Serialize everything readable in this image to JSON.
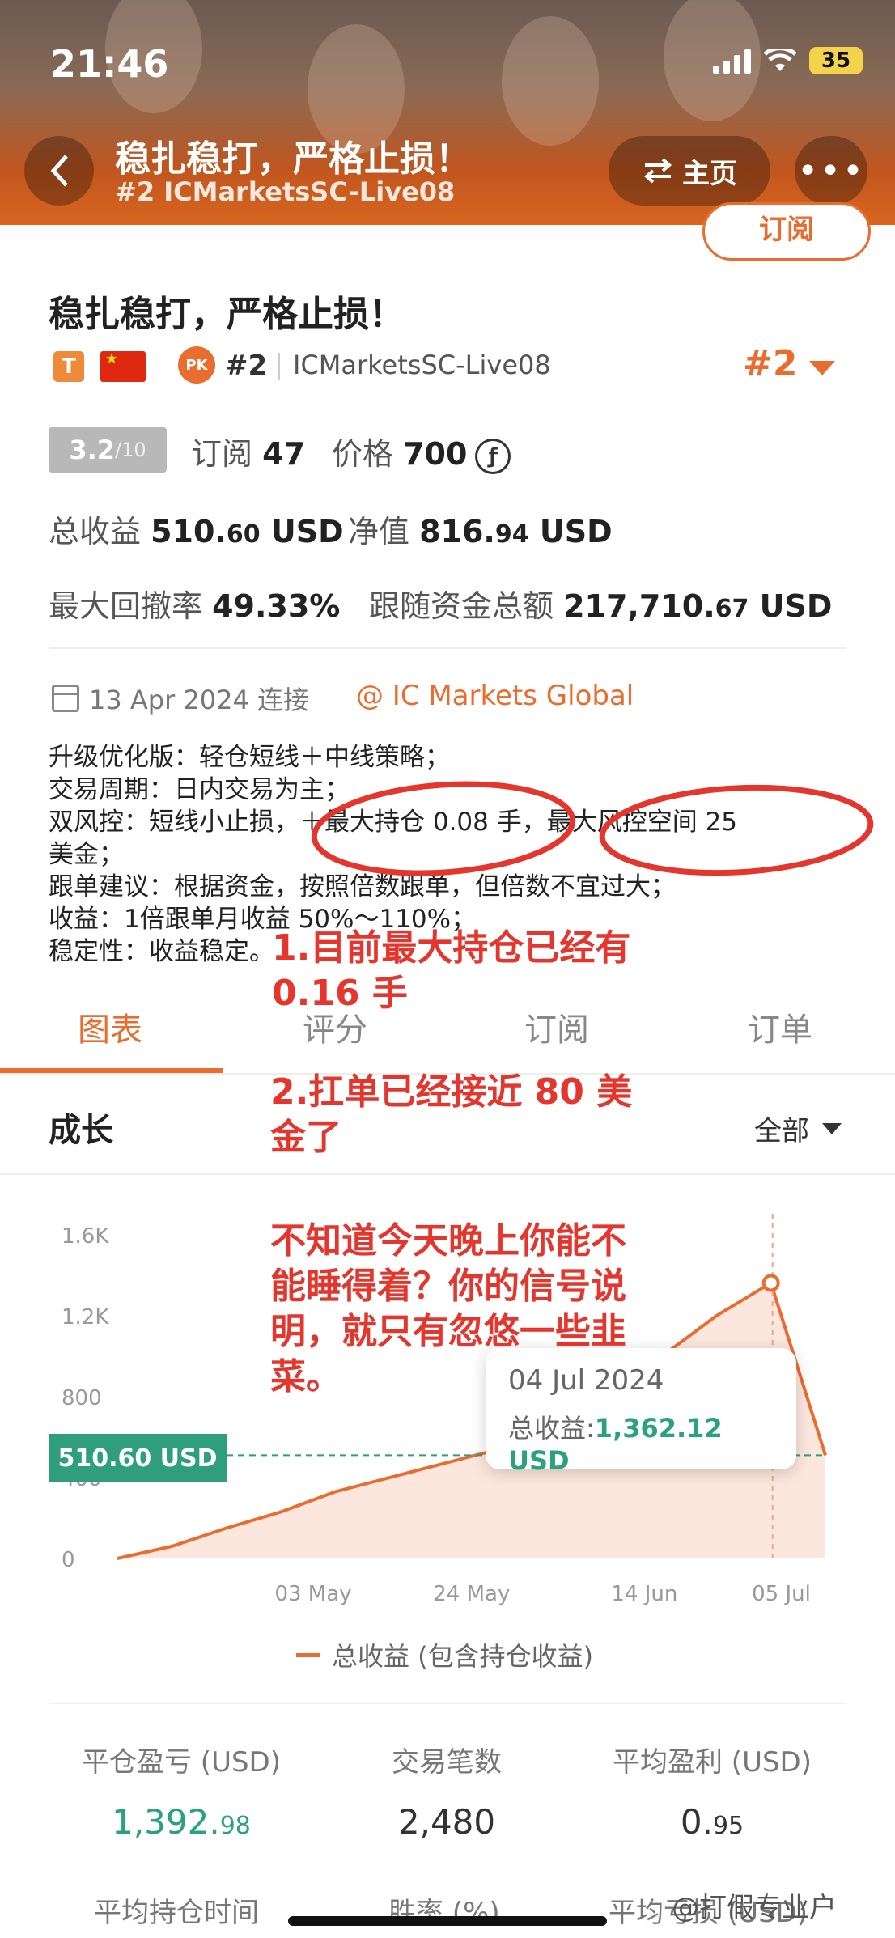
{
  "status_bar": {
    "time": "21:46",
    "battery": "35"
  },
  "header": {
    "title": "稳扎稳打，严格止损！",
    "subtitle": "#2 ICMarketsSC-Live08",
    "home_label": "主页",
    "more_label": "•••",
    "subscribe_label": "订阅"
  },
  "profile": {
    "title": "稳扎稳打，严格止损！",
    "tag": "T",
    "pk_badge": "PK",
    "rank": "#2",
    "server": "ICMarketsSC-Live08",
    "rank_right": "#2"
  },
  "stats": {
    "rating": "3.2",
    "rating_den": "/10",
    "subscribers_label": "订阅",
    "subscribers": "47",
    "price_label": "价格",
    "price": "700",
    "coin_icon": "ƒ",
    "total_profit_label": "总收益",
    "total_profit_int": "510.",
    "total_profit_dec": "60",
    "currency": "USD",
    "equity_label": "净值",
    "equity_int": "816.",
    "equity_dec": "94",
    "max_drawdown_label": "最大回撤率",
    "max_drawdown": "49.33%",
    "follow_funds_label": "跟随资金总额",
    "follow_funds_int": "217,710.",
    "follow_funds_dec": "67"
  },
  "connection": {
    "date": "13 Apr 2024 连接",
    "broker": "@ IC Markets Global"
  },
  "description": [
    "升级优化版：轻仓短线＋中线策略；",
    "交易周期：日内交易为主；",
    "双风控：短线小止损，＋最大持仓 0.08 手，最大风控空间 25",
    "美金；",
    "跟单建议：根据资金，按照倍数跟单，但倍数不宜过大；",
    "收益：1倍跟单月收益 50%～110%；",
    "稳定性：收益稳定。"
  ],
  "annotations": {
    "a1": "1.目前最大持仓已经有\n0.16 手",
    "a2": "2.扛单已经接近 80 美\n金了",
    "a3": "不知道今天晚上你能不\n能睡得着？你的信号说\n明，就只有忽悠一些韭\n菜。"
  },
  "tabs": [
    "图表",
    "评分",
    "订阅",
    "订单"
  ],
  "growth": {
    "title": "成长",
    "range": "全部"
  },
  "chart_data": {
    "type": "area",
    "x_ticks": [
      "03 May",
      "24 May",
      "14 Jun",
      "05 Jul"
    ],
    "y_ticks": [
      "1.6K",
      "1.2K",
      "800",
      "400",
      "0"
    ],
    "ylim": [
      0,
      1600
    ],
    "series": [
      {
        "name": "总收益 (包含持仓收益)",
        "points": [
          [
            "13 Apr",
            0
          ],
          [
            "20 Apr",
            60
          ],
          [
            "27 Apr",
            150
          ],
          [
            "03 May",
            230
          ],
          [
            "10 May",
            330
          ],
          [
            "17 May",
            400
          ],
          [
            "24 May",
            470
          ],
          [
            "31 May",
            540
          ],
          [
            "07 Jun",
            620
          ],
          [
            "14 Jun",
            800
          ],
          [
            "21 Jun",
            1000
          ],
          [
            "28 Jun",
            1200
          ],
          [
            "04 Jul",
            1362.12
          ],
          [
            "05 Jul",
            510.6
          ]
        ]
      }
    ],
    "current_value": "510.60 USD",
    "tooltip": {
      "date": "04 Jul 2024",
      "label": "总收益:",
      "value": "1,362.12 USD"
    },
    "colors": {
      "line": "#ea6d2f",
      "fill": "#fbe1d6",
      "reference": "#2f9e7a"
    }
  },
  "metrics": [
    {
      "label": "平仓盈亏 (USD)",
      "int": "1,392.",
      "dec": "98",
      "green": true
    },
    {
      "label": "交易笔数",
      "int": "2,480",
      "dec": "",
      "green": false
    },
    {
      "label": "平均盈利 (USD)",
      "int": "0.",
      "dec": "95",
      "green": false
    }
  ],
  "bottom_labels": [
    "平均持仓时间",
    "胜率 (%)",
    "平均亏损 (USD)"
  ],
  "watermark": "@打假专业户"
}
